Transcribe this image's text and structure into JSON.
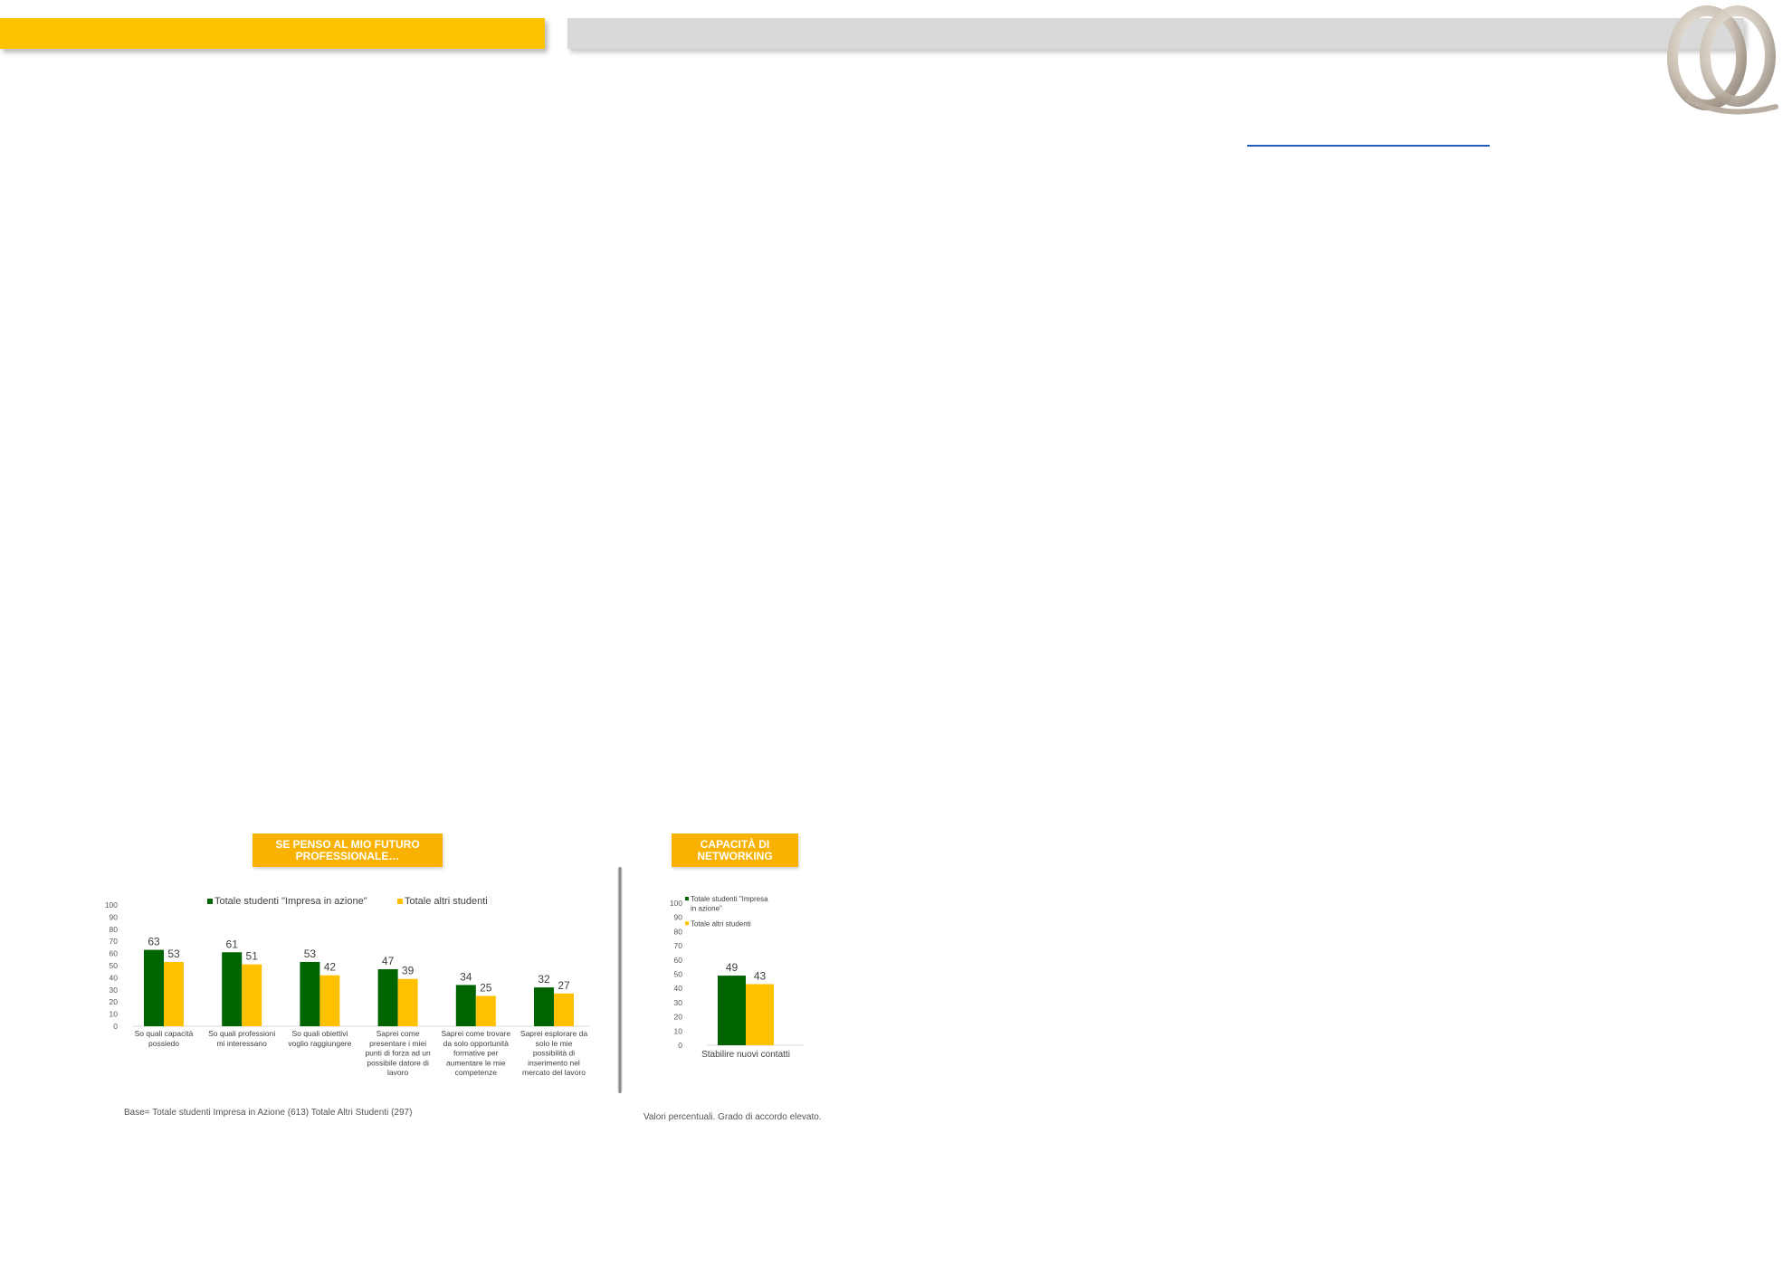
{
  "colors": {
    "header_yellow": "#fcc300",
    "header_grey": "#d9d9d9",
    "title_box": "#f9b200",
    "series_green": "#006400",
    "series_yellow": "#ffc000"
  },
  "logo": {
    "icon": "double-q-logo-icon"
  },
  "chart1_title": "SE PENSO AL MIO FUTURO PROFESSIONALE…",
  "chart2_title": "CAPACITÀ DI NETWORKING",
  "footnote_left": "Base= Totale studenti Impresa in Azione (613) Totale Altri Studenti (297)",
  "footnote_right": "Valori percentuali. Grado di accordo elevato.",
  "chart_data": [
    {
      "type": "bar",
      "title": "SE PENSO AL MIO FUTURO PROFESSIONALE…",
      "categories": [
        "So quali capacità possiedo",
        "So quali professioni mi interessano",
        "So quali obiettivi voglio raggiungere",
        "Saprei come presentare i miei punti di forza ad un possibile datore di lavoro",
        "Saprei come trovare da solo opportunità formative per aumentare le mie competenze",
        "Saprei esplorare da solo le mie possibilità di inserimento nel mercato del lavoro"
      ],
      "category_lines": [
        [
          "So quali capacità",
          "possiedo"
        ],
        [
          "So quali professioni",
          "mi interessano"
        ],
        [
          "So quali obiettivi",
          "voglio raggiungere"
        ],
        [
          "Saprei come",
          "presentare i miei",
          "punti di forza ad un",
          "possibile datore di",
          "lavoro"
        ],
        [
          "Saprei come trovare",
          "da solo opportunità",
          "formative per",
          "aumentare le mie",
          "competenze"
        ],
        [
          "Saprei esplorare da",
          "solo le mie",
          "possibilità di",
          "inserimento nel",
          "mercato del lavoro"
        ]
      ],
      "series": [
        {
          "name": "Totale studenti \"Impresa in azione\"",
          "values": [
            63,
            61,
            53,
            47,
            34,
            32
          ],
          "color": "#006400"
        },
        {
          "name": "Totale altri studenti",
          "values": [
            53,
            51,
            42,
            39,
            25,
            27
          ],
          "color": "#ffc000"
        }
      ],
      "yticks": [
        0,
        10,
        20,
        30,
        40,
        50,
        60,
        70,
        80,
        90,
        100
      ],
      "ylim": [
        0,
        100
      ],
      "legend": "top"
    },
    {
      "type": "bar",
      "title": "CAPACITÀ DI NETWORKING",
      "categories": [
        "Stabilire nuovi contatti"
      ],
      "category_lines": [
        [
          "Stabilire nuovi contatti"
        ]
      ],
      "series": [
        {
          "name": "Totale studenti \"Impresa in azione\"",
          "values": [
            49
          ],
          "color": "#006400"
        },
        {
          "name": "Totale altri studenti",
          "values": [
            43
          ],
          "color": "#ffc000"
        }
      ],
      "yticks": [
        0,
        10,
        20,
        30,
        40,
        50,
        60,
        70,
        80,
        90,
        100
      ],
      "ylim": [
        0,
        100
      ],
      "legend": "top-left"
    }
  ]
}
